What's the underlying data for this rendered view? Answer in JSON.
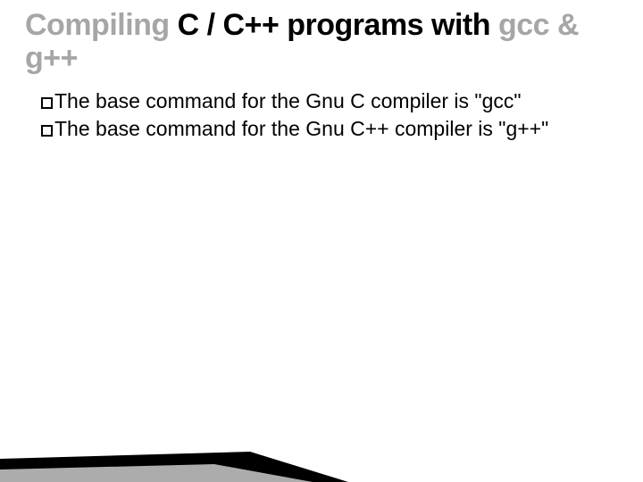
{
  "title": {
    "part1": "Compiling",
    "part2": "C / C++ programs with",
    "part3": "gcc & g++"
  },
  "bullets": [
    "The base command for the Gnu C compiler is \"gcc\"",
    "The base command for the Gnu C++ compiler is \"g++\""
  ]
}
